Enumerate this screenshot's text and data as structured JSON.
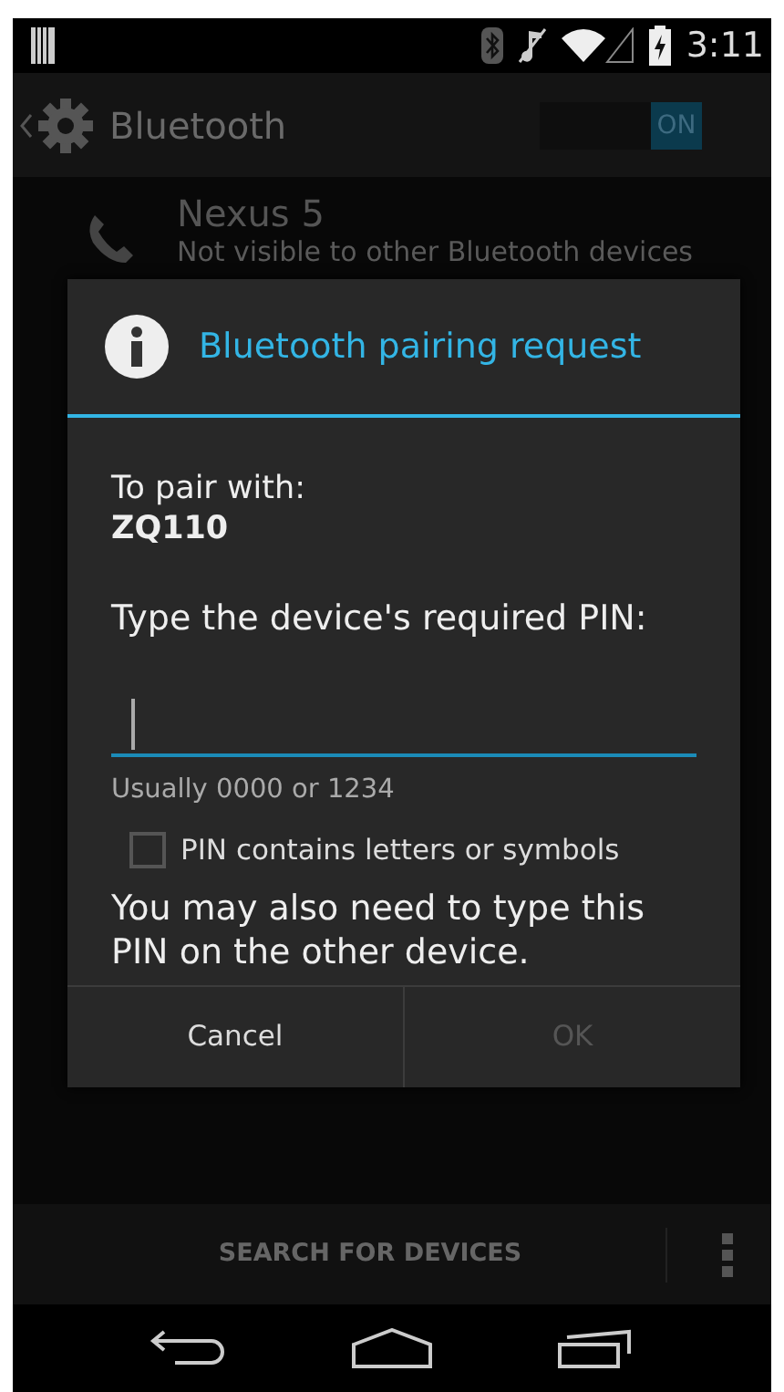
{
  "status_bar": {
    "time": "3:11"
  },
  "action_bar": {
    "title": "Bluetooth",
    "toggle": {
      "label": "ON",
      "on": true
    }
  },
  "device": {
    "name": "Nexus 5",
    "status": "Not visible to other Bluetooth devices"
  },
  "dialog": {
    "title": "Bluetooth pairing request",
    "pair_label": "To pair with:",
    "device_name": "ZQ110",
    "prompt": "Type the device's required PIN:",
    "hint": "Usually 0000 or 1234",
    "checkbox": {
      "label": "PIN contains letters or symbols",
      "checked": false
    },
    "note": "You may also need to type this PIN on the other device.",
    "buttons": [
      {
        "label": "Cancel",
        "disabled": false
      },
      {
        "label": "OK",
        "disabled": true
      }
    ]
  },
  "bottom_bar": {
    "action": "SEARCH FOR DEVICES"
  }
}
